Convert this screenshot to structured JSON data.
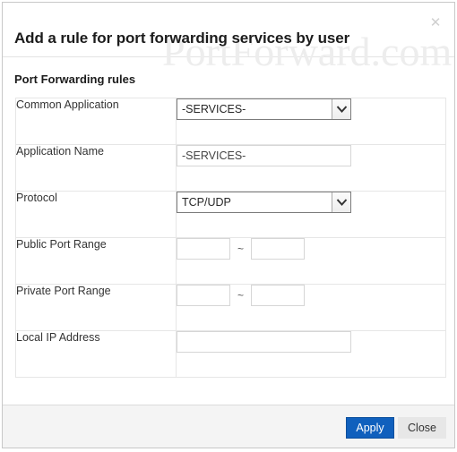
{
  "dialog": {
    "title": "Add a rule for port forwarding services by user",
    "close_icon": "close-x-icon",
    "watermark": "PortForward.com",
    "section_title": "Port Forwarding rules"
  },
  "form": {
    "rows": [
      {
        "label": "Common Application",
        "type": "select",
        "value": "-SERVICES-"
      },
      {
        "label": "Application Name",
        "type": "text",
        "value": "-SERVICES-"
      },
      {
        "label": "Protocol",
        "type": "select",
        "value": "TCP/UDP"
      },
      {
        "label": "Public Port Range",
        "type": "range",
        "start": "",
        "separator": "~",
        "end": ""
      },
      {
        "label": "Private Port Range",
        "type": "range",
        "start": "",
        "separator": "~",
        "end": ""
      },
      {
        "label": "Local IP Address",
        "type": "text",
        "value": ""
      }
    ]
  },
  "footer": {
    "apply_label": "Apply",
    "close_label": "Close"
  },
  "colors": {
    "primary": "#1060bd",
    "secondary": "#e7e7e7",
    "border": "#e6e6e6",
    "watermark": "#ededed"
  }
}
